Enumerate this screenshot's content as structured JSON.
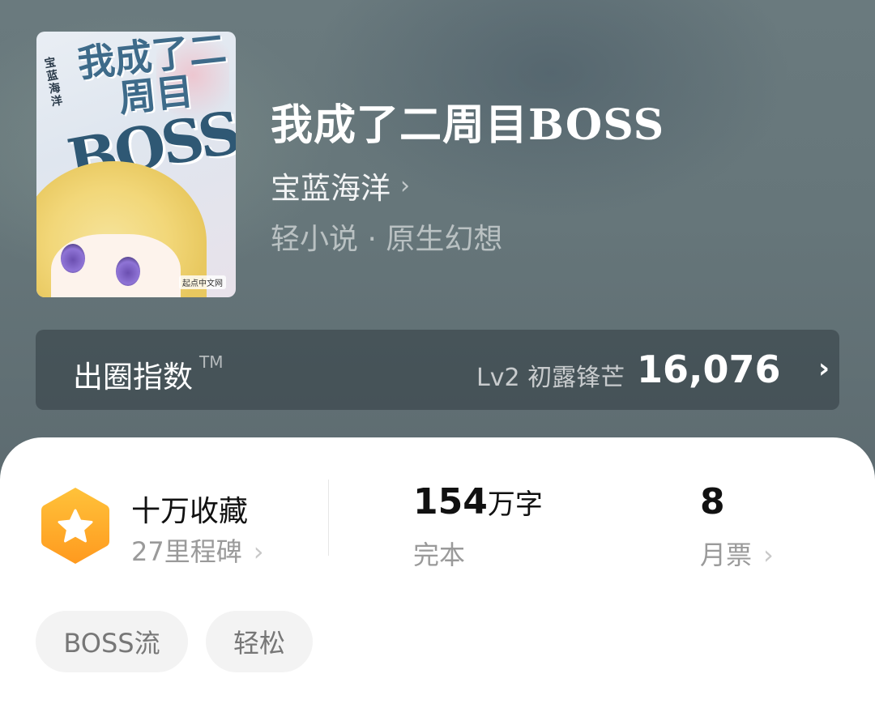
{
  "book": {
    "title": "我成了二周目BOSS",
    "author": "宝蓝海洋",
    "author_chevron": "›",
    "category": "轻小说 · 原生幻想"
  },
  "cover": {
    "title_art": "我成了二周目",
    "boss_art": "BOSS",
    "author_art": "宝蓝海洋",
    "brand": "起点中文网"
  },
  "index": {
    "label": "出圈指数",
    "trademark": "TM",
    "level": "Lv2 初露锋芒",
    "value": "16,076",
    "arrow": "›"
  },
  "stats": {
    "collection": {
      "icon": "star-icon",
      "title": "十万收藏",
      "sub": "27里程碑",
      "chevron": "›"
    },
    "words": {
      "number": "154",
      "unit": "万字",
      "sub": "完本"
    },
    "tickets": {
      "number": "8",
      "sub": "月票",
      "chevron": "›"
    }
  },
  "tags": [
    "BOSS流",
    "轻松"
  ],
  "colors": {
    "accent_orange": "#f5a623",
    "hero_bg": "#66767a"
  }
}
